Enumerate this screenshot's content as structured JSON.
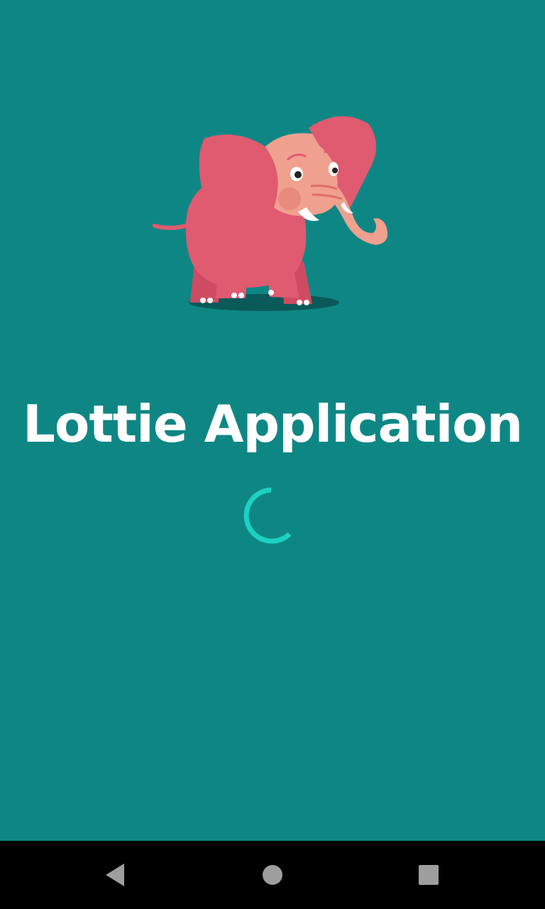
{
  "app": {
    "title": "Lottie Application"
  },
  "splash": {
    "illustration": "pink-elephant",
    "spinner": "loading-spinner"
  },
  "navbar": {
    "back_icon": "back-triangle-icon",
    "home_icon": "home-circle-icon",
    "recents_icon": "recents-square-icon"
  },
  "colors": {
    "background": "#0e8784",
    "title": "#ffffff",
    "spinner": "#1dd1c3",
    "elephant_body": "#e05a70",
    "elephant_head": "#f0a08e",
    "navbar": "#000000",
    "nav_icons": "#9e9e9e"
  }
}
